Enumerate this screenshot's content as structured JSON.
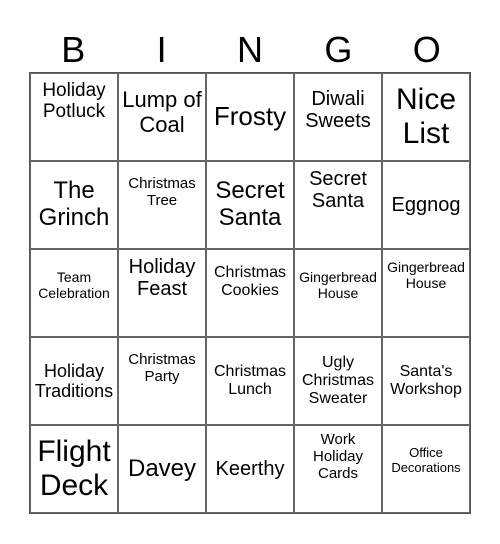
{
  "header": {
    "letters": [
      "B",
      "I",
      "N",
      "G",
      "O"
    ]
  },
  "grid": {
    "rows": [
      [
        "Holiday Potluck",
        "Lump of Coal",
        "Frosty",
        "Diwali Sweets",
        "Nice List"
      ],
      [
        "The Grinch",
        "Christmas Tree",
        "Secret Santa",
        "Secret Santa",
        "Eggnog"
      ],
      [
        "Team Celebration",
        "Holiday Feast",
        "Christmas Cookies",
        "Gingerbread House",
        "Gingerbread House"
      ],
      [
        "Holiday Traditions",
        "Christmas Party",
        "Christmas Lunch",
        "Ugly Christmas Sweater",
        "Santa's Workshop"
      ],
      [
        "Flight Deck",
        "Davey",
        "Keerthy",
        "Work Holiday Cards",
        "Office Decorations"
      ]
    ]
  }
}
